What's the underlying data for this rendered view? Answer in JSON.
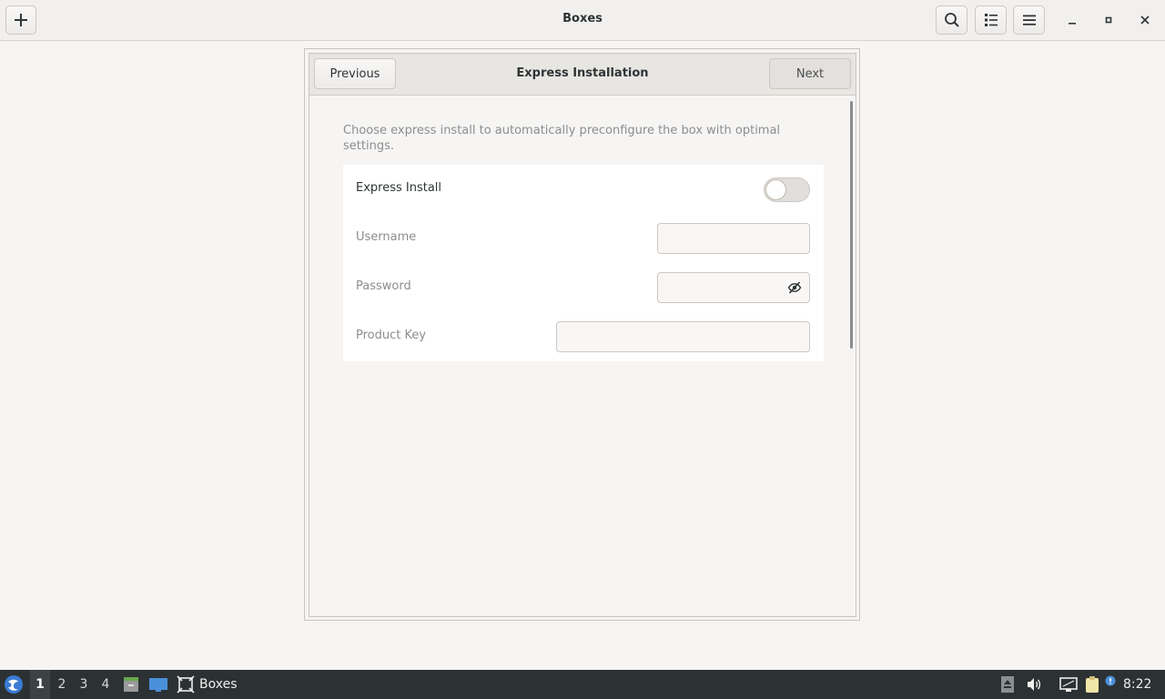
{
  "window": {
    "title": "Boxes"
  },
  "header_buttons": {
    "new": "new-box",
    "search": "search",
    "view": "view-list",
    "menu": "main-menu"
  },
  "dialog": {
    "title": "Express Installation",
    "previous_label": "Previous",
    "next_label": "Next",
    "description": "Choose express install to automatically preconfigure the box with optimal settings.",
    "express_install": {
      "label": "Express Install",
      "enabled": false
    },
    "fields": {
      "username": {
        "label": "Username",
        "value": ""
      },
      "password": {
        "label": "Password",
        "value": ""
      },
      "product_key": {
        "label": "Product Key",
        "value": ""
      }
    }
  },
  "taskbar": {
    "workspaces": [
      "1",
      "2",
      "3",
      "4"
    ],
    "active_workspace": "1",
    "task_label": "Boxes",
    "clock": "8:22"
  },
  "colors": {
    "background": "#f6f5f4",
    "taskbar": "#2c3133",
    "text": "#2e3436",
    "muted_text": "#8b8e8f"
  }
}
